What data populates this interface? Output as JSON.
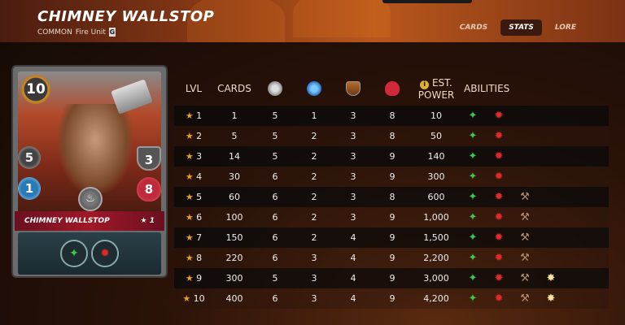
{
  "header": {
    "title": "CHIMNEY WALLSTOP",
    "rarity": "COMMON",
    "element_type": "Fire Unit",
    "edition_badge": "G",
    "tabs": [
      {
        "label": "CARDS",
        "active": false
      },
      {
        "label": "STATS",
        "active": true
      },
      {
        "label": "LORE",
        "active": false
      }
    ]
  },
  "card": {
    "mana": "10",
    "melee": "5",
    "speed": "1",
    "armor": "3",
    "health": "8",
    "name": "CHIMNEY WALLSTOP",
    "level_label": "★ 1",
    "element_icon": "fire-element-icon",
    "abilities_icons": [
      "green-claw-icon",
      "red-rage-icon"
    ]
  },
  "table": {
    "headers": {
      "lvl": "LVL",
      "cards": "CARDS",
      "power_line1": "EST.",
      "power_line2": "POWER",
      "abilities": "ABILITIES",
      "info_icon": "i"
    },
    "rows": [
      {
        "lvl": "★ 1",
        "cards": "1",
        "melee": "5",
        "speed": "1",
        "armor": "3",
        "health": "8",
        "power": "10",
        "abilities": [
          "green-claw-icon",
          "red-rage-icon"
        ]
      },
      {
        "lvl": "★ 2",
        "cards": "5",
        "melee": "5",
        "speed": "2",
        "armor": "3",
        "health": "8",
        "power": "50",
        "abilities": [
          "green-claw-icon",
          "red-rage-icon"
        ]
      },
      {
        "lvl": "★ 3",
        "cards": "14",
        "melee": "5",
        "speed": "2",
        "armor": "3",
        "health": "9",
        "power": "140",
        "abilities": [
          "green-claw-icon",
          "red-rage-icon"
        ]
      },
      {
        "lvl": "★ 4",
        "cards": "30",
        "melee": "6",
        "speed": "2",
        "armor": "3",
        "health": "9",
        "power": "300",
        "abilities": [
          "green-claw-icon",
          "red-rage-icon"
        ]
      },
      {
        "lvl": "★ 5",
        "cards": "60",
        "melee": "6",
        "speed": "2",
        "armor": "3",
        "health": "8",
        "power": "600",
        "abilities": [
          "green-claw-icon",
          "red-rage-icon",
          "hammer-icon"
        ]
      },
      {
        "lvl": "★ 6",
        "cards": "100",
        "melee": "6",
        "speed": "2",
        "armor": "3",
        "health": "9",
        "power": "1,000",
        "abilities": [
          "green-claw-icon",
          "red-rage-icon",
          "hammer-icon"
        ]
      },
      {
        "lvl": "★ 7",
        "cards": "150",
        "melee": "6",
        "speed": "2",
        "armor": "4",
        "health": "9",
        "power": "1,500",
        "abilities": [
          "green-claw-icon",
          "red-rage-icon",
          "hammer-icon"
        ]
      },
      {
        "lvl": "★ 8",
        "cards": "220",
        "melee": "6",
        "speed": "3",
        "armor": "4",
        "health": "9",
        "power": "2,200",
        "abilities": [
          "green-claw-icon",
          "red-rage-icon",
          "hammer-icon"
        ]
      },
      {
        "lvl": "★ 9",
        "cards": "300",
        "melee": "5",
        "speed": "3",
        "armor": "4",
        "health": "9",
        "power": "3,000",
        "abilities": [
          "green-claw-icon",
          "red-rage-icon",
          "hammer-icon",
          "gold-burst-icon"
        ]
      },
      {
        "lvl": "★ 10",
        "cards": "400",
        "melee": "6",
        "speed": "3",
        "armor": "4",
        "health": "9",
        "power": "4,200",
        "abilities": [
          "green-claw-icon",
          "red-rage-icon",
          "hammer-icon",
          "gold-burst-icon"
        ]
      }
    ]
  },
  "icon_glyphs": {
    "green-claw-icon": "✦",
    "red-rage-icon": "✹",
    "hammer-icon": "⚒",
    "gold-burst-icon": "✸"
  },
  "colors": {
    "star": "#e8a020",
    "header_gradient_mid": "#b8571c",
    "nameplate": "#a01828"
  }
}
